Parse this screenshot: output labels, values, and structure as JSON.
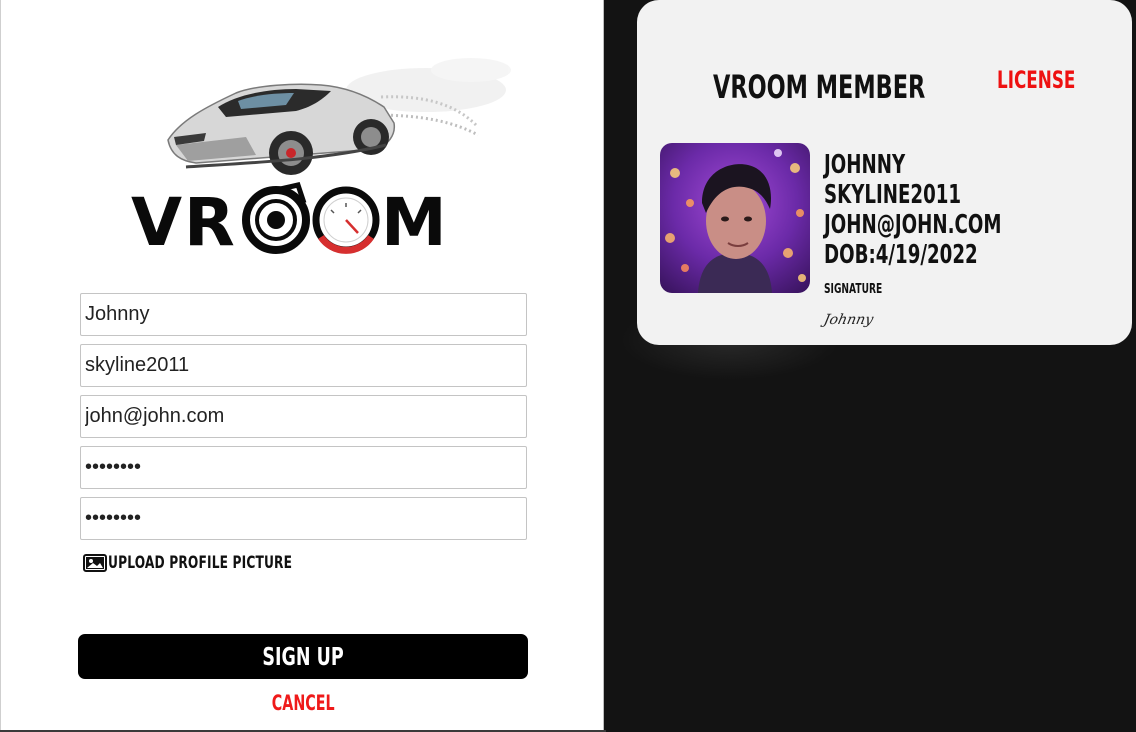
{
  "logo": {
    "text": "VROOM",
    "accent": "#d62f2f"
  },
  "form": {
    "name_value": "Johnny",
    "username_value": "skyline2011",
    "email_value": "john@john.com",
    "password_value": "••••••••",
    "confirm_password_value": "••••••••",
    "upload_label": "Upload Profile Picture",
    "signup_label": "Sign Up",
    "cancel_label": "Cancel"
  },
  "card": {
    "title": "VROOM MEMBER",
    "license_label": "LICENSE",
    "name": "JOHNNY",
    "username": "SKYLINE2011",
    "email": "JOHN@JOHN.COM",
    "dob": "DOB:4/19/2022",
    "signature_label": "SIGNATURE",
    "signature_value": "Johnny"
  },
  "colors": {
    "accent_red": "#ee1111",
    "button_bg": "#000000",
    "card_bg": "#f2f2f2",
    "backdrop": "#131313"
  },
  "icons": {
    "upload": "image-icon"
  }
}
